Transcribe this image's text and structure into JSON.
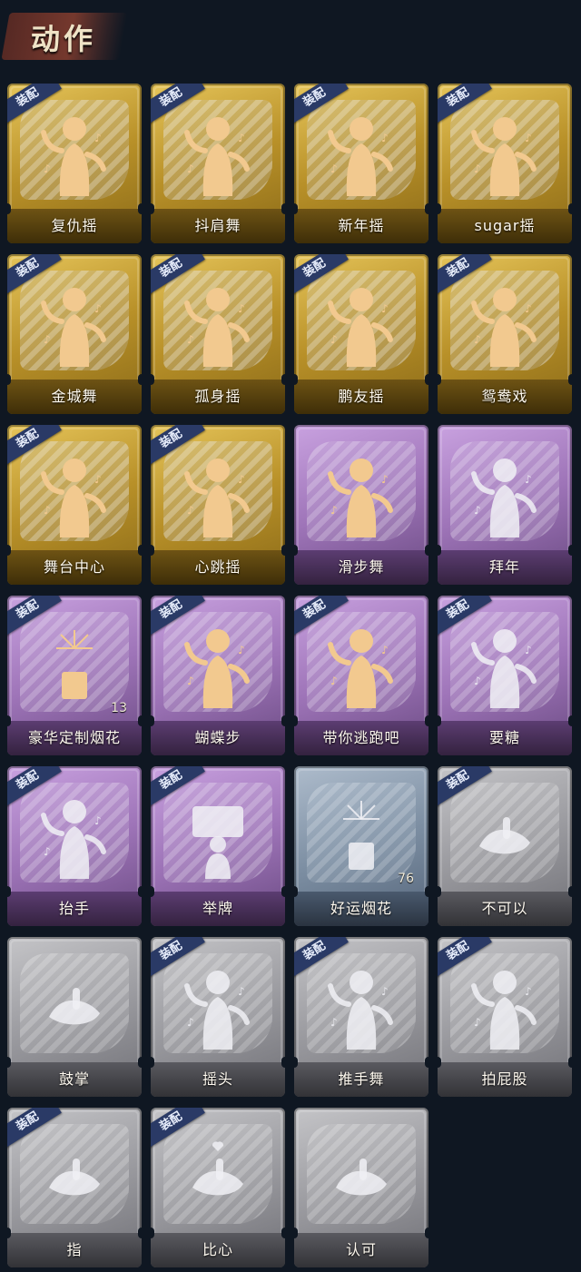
{
  "header": {
    "title": "动作"
  },
  "badge_label": "装配",
  "colors": {
    "gold": "#c9a53c",
    "purple": "#a57cc0",
    "blue": "#8194aa",
    "grey": "#a0a0a5",
    "badge": "#2a3a66",
    "background": "#0f1722"
  },
  "actions": [
    {
      "name": "复仇摇",
      "tier": "gold",
      "equipped": true,
      "icon": "dancer-pointing-up-icon"
    },
    {
      "name": "抖肩舞",
      "tier": "gold",
      "equipped": true,
      "icon": "dancer-stars-icon"
    },
    {
      "name": "新年摇",
      "tier": "gold",
      "equipped": true,
      "icon": "dancer-music-icon"
    },
    {
      "name": "sugar摇",
      "tier": "gold",
      "equipped": true,
      "icon": "dancer-music-icon"
    },
    {
      "name": "金城舞",
      "tier": "gold",
      "equipped": true,
      "icon": "dancer-sparkle-icon"
    },
    {
      "name": "孤身摇",
      "tier": "gold",
      "equipped": true,
      "icon": "dancer-stars-icon"
    },
    {
      "name": "鹏友摇",
      "tier": "gold",
      "equipped": true,
      "icon": "dancer-pointing-icon"
    },
    {
      "name": "鸳鸯戏",
      "tier": "gold",
      "equipped": true,
      "icon": "dancer-music-icon"
    },
    {
      "name": "舞台中心",
      "tier": "gold",
      "equipped": true,
      "icon": "dancer-sparkle-icon"
    },
    {
      "name": "心跳摇",
      "tier": "gold",
      "equipped": true,
      "icon": "dancer-wave-icon"
    },
    {
      "name": "滑步舞",
      "tier": "purple",
      "equipped": false,
      "icon": "dancer-music-icon"
    },
    {
      "name": "拜年",
      "tier": "purple",
      "equipped": false,
      "icon": "greeting-figure-icon"
    },
    {
      "name": "豪华定制烟花",
      "tier": "purple",
      "equipped": true,
      "icon": "firework-box-icon",
      "count": "13"
    },
    {
      "name": "蝴蝶步",
      "tier": "purple",
      "equipped": true,
      "icon": "dancer-pointing-icon"
    },
    {
      "name": "带你逃跑吧",
      "tier": "purple",
      "equipped": true,
      "icon": "dancer-pointing-icon"
    },
    {
      "name": "要糖",
      "tier": "purple",
      "equipped": true,
      "icon": "figure-reaching-icon"
    },
    {
      "name": "抬手",
      "tier": "purple",
      "equipped": true,
      "icon": "figure-raise-hand-icon"
    },
    {
      "name": "举牌",
      "tier": "purple",
      "equipped": true,
      "icon": "sign-holding-icon"
    },
    {
      "name": "好运烟花",
      "tier": "blue",
      "equipped": false,
      "icon": "firework-can-icon",
      "count": "76"
    },
    {
      "name": "不可以",
      "tier": "grey",
      "equipped": true,
      "icon": "finger-wag-icon"
    },
    {
      "name": "鼓掌",
      "tier": "grey",
      "equipped": false,
      "icon": "clapping-hands-icon"
    },
    {
      "name": "摇头",
      "tier": "grey",
      "equipped": true,
      "icon": "figure-shake-head-icon"
    },
    {
      "name": "推手舞",
      "tier": "grey",
      "equipped": true,
      "icon": "figure-push-hands-icon"
    },
    {
      "name": "拍屁股",
      "tier": "grey",
      "equipped": true,
      "icon": "figure-slap-icon"
    },
    {
      "name": "指",
      "tier": "grey",
      "equipped": true,
      "icon": "pointing-hand-icon"
    },
    {
      "name": "比心",
      "tier": "grey",
      "equipped": true,
      "icon": "finger-heart-icon"
    },
    {
      "name": "认可",
      "tier": "grey",
      "equipped": false,
      "icon": "thumbs-up-icon"
    }
  ]
}
